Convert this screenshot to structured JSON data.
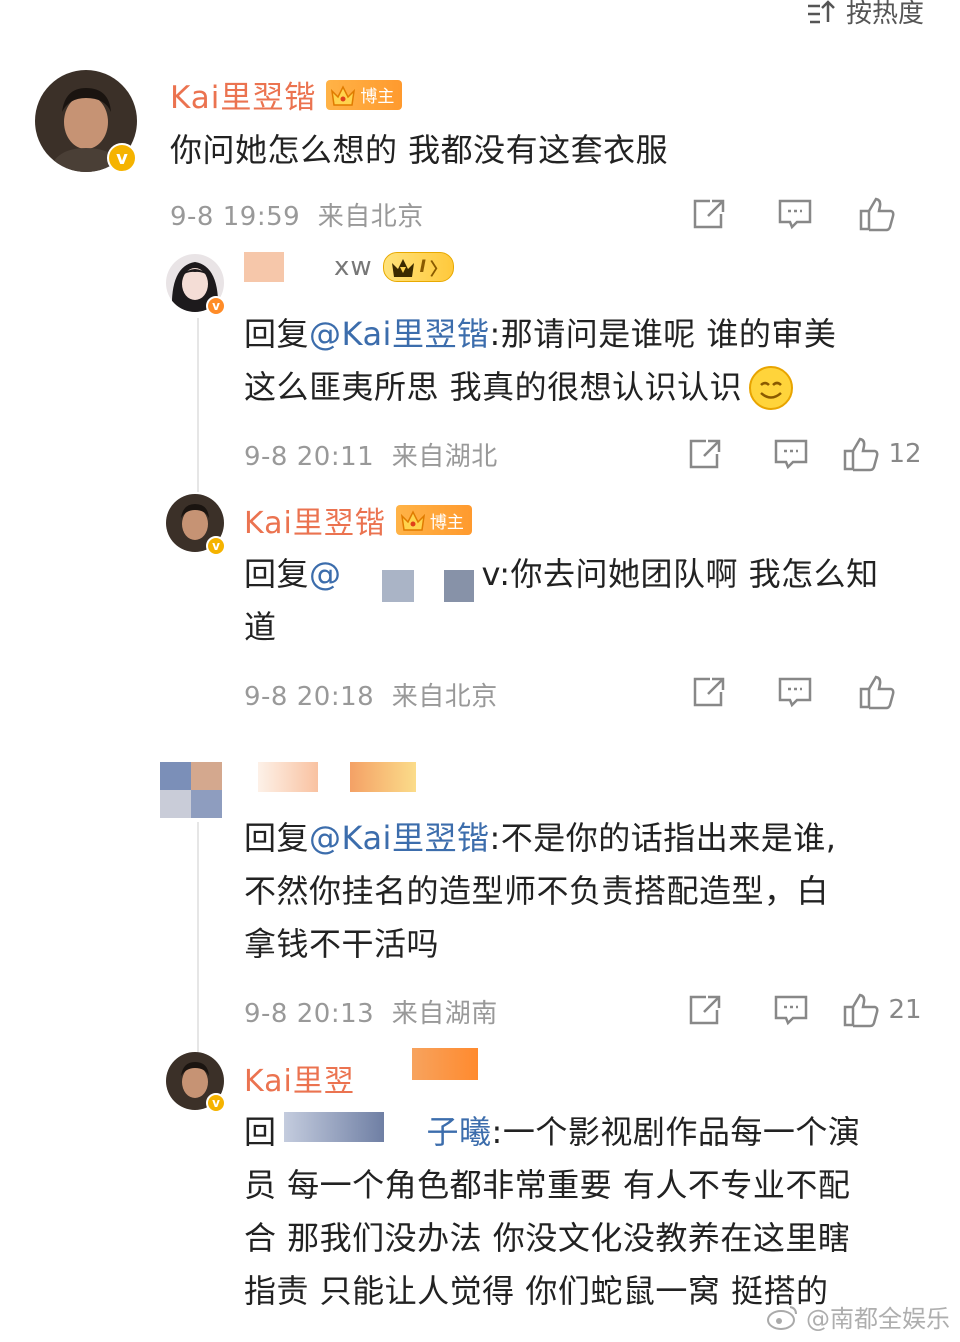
{
  "sort": {
    "label": "按热度"
  },
  "comments": [
    {
      "user": "Kai里翌锴",
      "badge": "博主",
      "text": "你问她怎么想的 我都没有这套衣服",
      "time": "9-8 19:59",
      "location": "来自北京",
      "likes": ""
    },
    {
      "user": "xw",
      "badge": "I",
      "reply_prefix": "回复",
      "mention": "@Kai里翌锴",
      "text_line1": ":那请问是谁呢 谁的审美",
      "text_line2": "这么匪夷所思 我真的很想认识认识",
      "time": "9-8 20:11",
      "location": "来自湖北",
      "likes": "12"
    },
    {
      "user": "Kai里翌锴",
      "badge": "博主",
      "reply_prefix": "回复",
      "mention": "@",
      "text_line1": "v:你去问她团队啊 我怎么知",
      "text_line2": "道",
      "time": "9-8 20:18",
      "location": "来自北京",
      "likes": ""
    },
    {
      "user": "",
      "reply_prefix": "回复",
      "mention": "@Kai里翌锴",
      "text_line1": ":不是你的话指出来是谁,",
      "text_line2": "不然你挂名的造型师不负责搭配造型，白",
      "text_line3": "拿钱不干活吗",
      "time": "9-8 20:13",
      "location": "来自湖南",
      "likes": "21"
    },
    {
      "user": "Kai里翌",
      "reply_prefix": "回",
      "mention": "子曦",
      "text_line1": ":一个影视剧作品每一个演",
      "text_line2": "员 每一个角色都非常重要 有人不专业不配",
      "text_line3": "合 那我们没办法 你没文化没教养在这里瞎",
      "text_line4": "指责 只能让人觉得 你们蛇鼠一窝 挺搭的"
    }
  ],
  "watermark": "@南都全娱乐",
  "colors": {
    "name": "#eb7350",
    "mention": "#3c6dac",
    "meta": "#999999",
    "vbadge": "#f5b300"
  }
}
